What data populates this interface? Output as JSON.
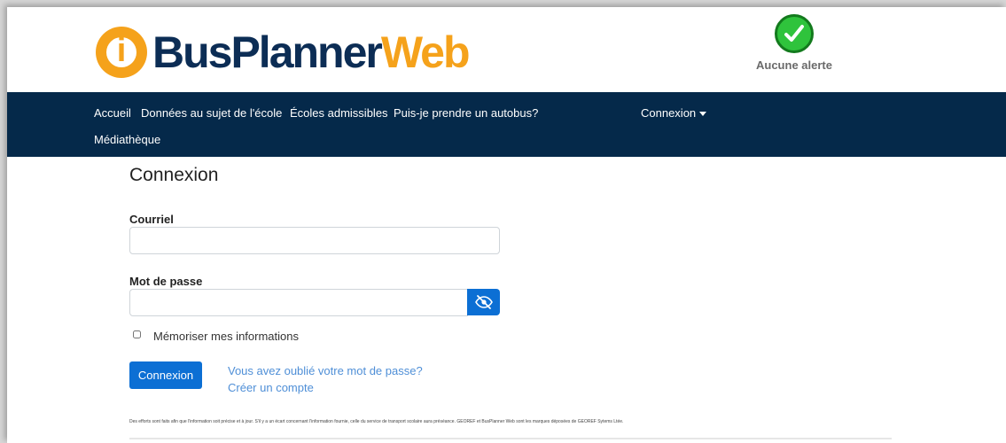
{
  "header": {
    "logo_text_primary": "BusPlanner",
    "logo_text_accent": "Web",
    "logo_mark": "i",
    "alert_icon": "check-circle-icon",
    "alert_label": "Aucune alerte"
  },
  "nav": {
    "items": [
      "Accueil",
      "Données au sujet de l'école",
      "Écoles admissibles",
      "Puis-je prendre un autobus?",
      "Médiathèque"
    ],
    "account_label": "Connexion"
  },
  "form": {
    "title": "Connexion",
    "email_label": "Courriel",
    "email_value": "",
    "password_label": "Mot de passe",
    "password_value": "",
    "toggle_visibility_icon": "eye-slash-icon",
    "remember_label": "Mémoriser mes informations",
    "remember_checked": false,
    "submit_label": "Connexion",
    "forgot_link": "Vous avez oublié votre mot de passe?",
    "create_link": "Créer un compte"
  },
  "footer": {
    "note": "Des efforts sont faits afin que l'information soit précise et à jour. S'il y a un écart concernant l'information fournie, celle du service de transport scolaire aura préséance. GEOREF et BusPlanner Web sont les marques déposées de GEOREF Sytems Ltée."
  },
  "colors": {
    "navbar": "#05294a",
    "primary_button": "#0c6fd4",
    "logo_orange": "#f5a21b",
    "logo_navy": "#0c2d55",
    "alert_green": "#2fc33c",
    "link": "#4f8fd7"
  }
}
